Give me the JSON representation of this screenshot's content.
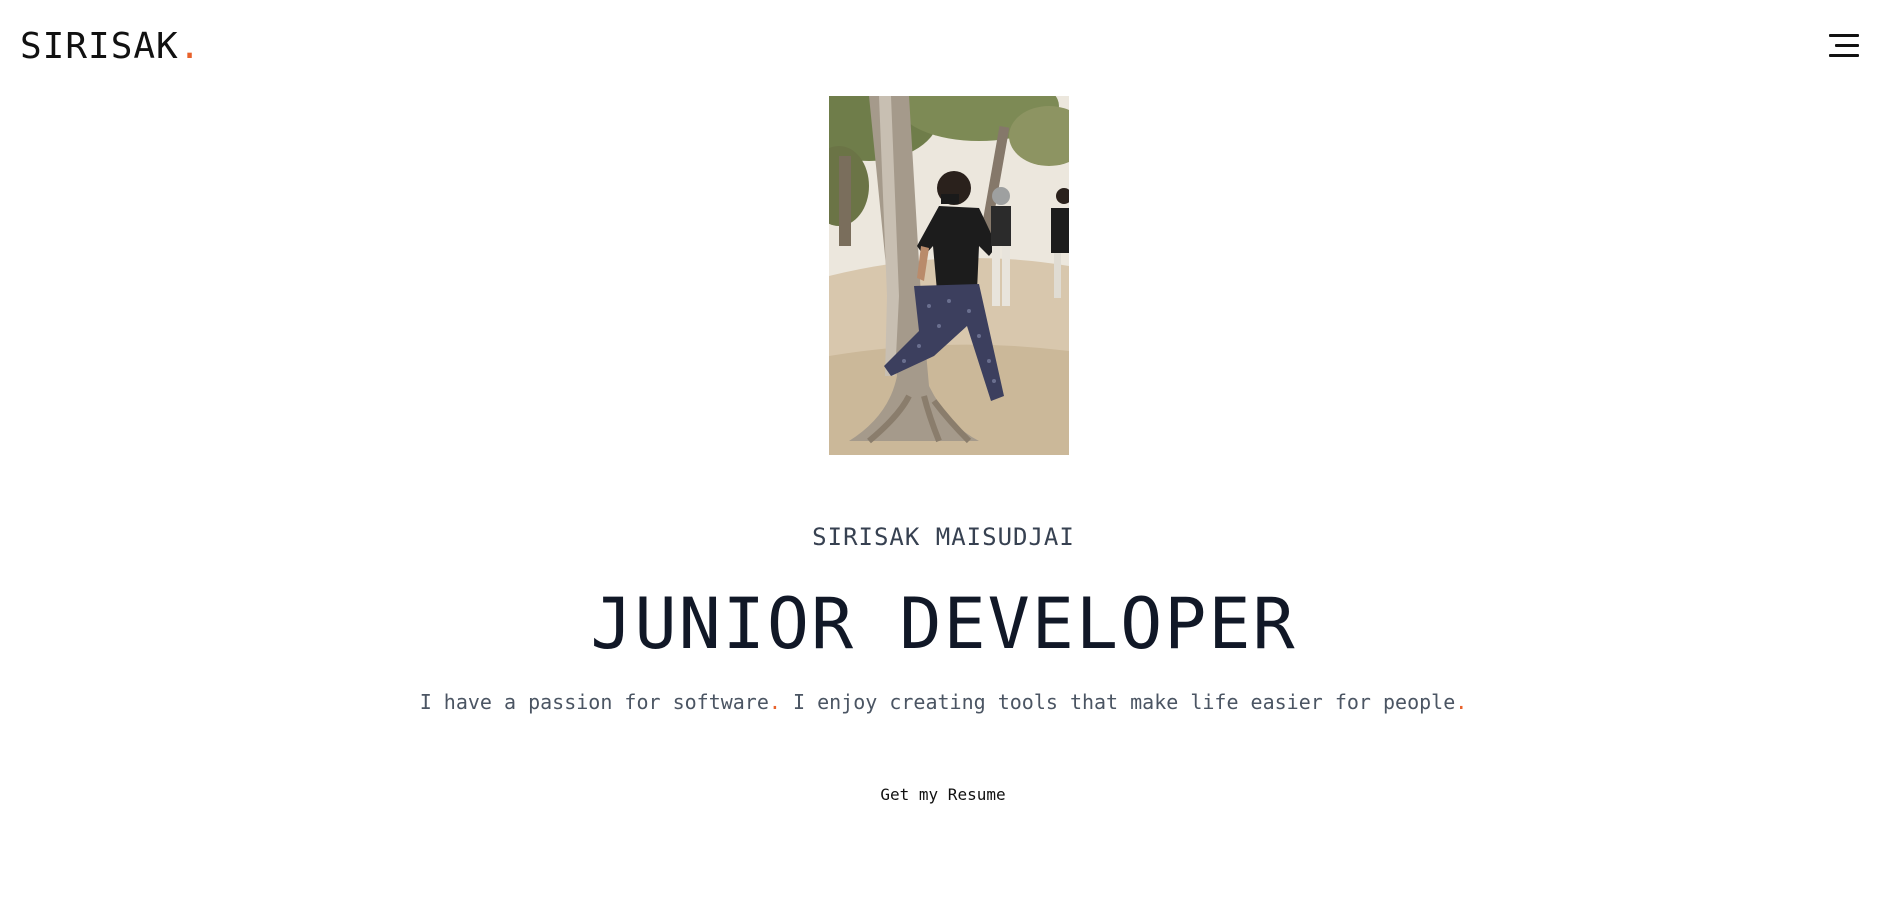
{
  "header": {
    "logo_text": "SIRISAK",
    "logo_dot": "."
  },
  "hero": {
    "name": "SIRISAK MAISUDJAI",
    "role": "JUNIOR DEVELOPER",
    "tagline_part1": "I have a passion for software",
    "tagline_dot1": ".",
    "tagline_part2": " I enjoy creating tools that make life easier for people",
    "tagline_dot2": ".",
    "resume_label": "Get my Resume"
  },
  "colors": {
    "accent": "#e8622c",
    "text_dark": "#111827",
    "text_muted": "#4b5563",
    "background": "#ffffff"
  },
  "icons": {
    "menu": "hamburger-menu-icon"
  }
}
